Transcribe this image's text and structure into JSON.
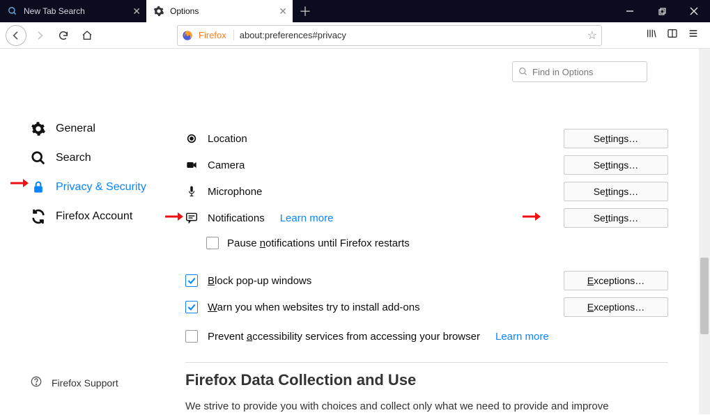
{
  "tabs": {
    "inactive": "New Tab Search",
    "active": "Options"
  },
  "url": {
    "brand": "Firefox",
    "value": "about:preferences#privacy"
  },
  "search_options_placeholder": "Find in Options",
  "sidebar": {
    "general": "General",
    "search": "Search",
    "privacy": "Privacy & Security",
    "account": "Firefox Account",
    "support": "Firefox Support"
  },
  "permissions": {
    "location": "Location",
    "camera": "Camera",
    "microphone": "Microphone",
    "notifications": "Notifications",
    "learn_more": "Learn more",
    "pause_notifications_pre": "Pause ",
    "pause_notifications_u": "n",
    "pause_notifications_post": "otifications until Firefox restarts",
    "block_popups_u": "B",
    "block_popups_post": "lock pop-up windows",
    "warn_addons_u": "W",
    "warn_addons_post": "arn you when websites try to install add-ons",
    "prevent_a11y_pre": "Prevent ",
    "prevent_a11y_u": "a",
    "prevent_a11y_post": "ccessibility services from accessing your browser"
  },
  "buttons": {
    "settings_pre": "Se",
    "settings_u": "t",
    "settings_post": "tings…",
    "exceptions_u": "E",
    "exceptions_post": "xceptions…"
  },
  "data_section": {
    "title": "Firefox Data Collection and Use",
    "text": "We strive to provide you with choices and collect only what we need to provide and improve"
  }
}
